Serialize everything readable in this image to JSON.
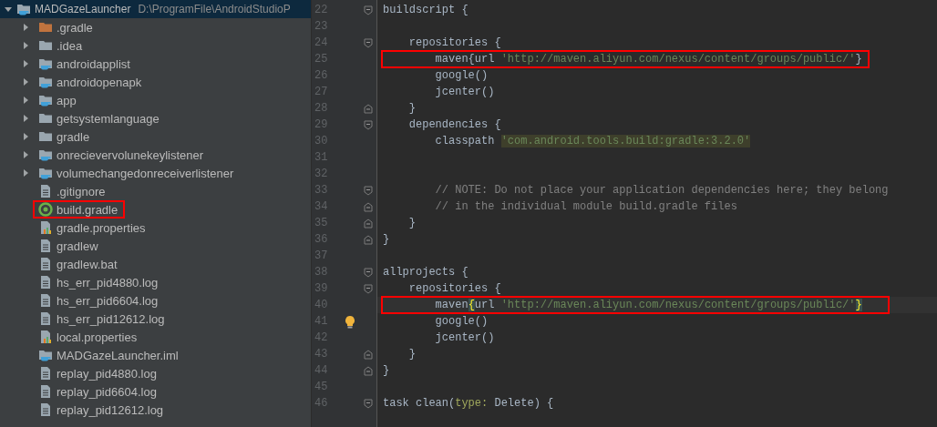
{
  "project_tree": {
    "root": {
      "name": "MADGazeLauncher",
      "path": "D:\\ProgramFile\\AndroidStudioP",
      "expanded": true
    },
    "items": [
      {
        "name": ".gradle",
        "kind": "excluded-folder",
        "expanded": false,
        "highlighted": false
      },
      {
        "name": ".idea",
        "kind": "folder",
        "expanded": false,
        "highlighted": false
      },
      {
        "name": "androidapplist",
        "kind": "module",
        "expanded": false,
        "highlighted": false
      },
      {
        "name": "androidopenapk",
        "kind": "module",
        "expanded": false,
        "highlighted": false
      },
      {
        "name": "app",
        "kind": "module",
        "expanded": false,
        "highlighted": false
      },
      {
        "name": "getsystemlanguage",
        "kind": "folder",
        "expanded": false,
        "highlighted": false
      },
      {
        "name": "gradle",
        "kind": "folder",
        "expanded": false,
        "highlighted": false
      },
      {
        "name": "onrecievervolunekeylistener",
        "kind": "module",
        "expanded": false,
        "highlighted": false
      },
      {
        "name": "volumechangedonreceiverlistener",
        "kind": "module",
        "expanded": false,
        "highlighted": false
      },
      {
        "name": ".gitignore",
        "kind": "file",
        "highlighted": false
      },
      {
        "name": "build.gradle",
        "kind": "gradle",
        "highlighted": true
      },
      {
        "name": "gradle.properties",
        "kind": "properties",
        "highlighted": false
      },
      {
        "name": "gradlew",
        "kind": "file",
        "highlighted": false
      },
      {
        "name": "gradlew.bat",
        "kind": "file",
        "highlighted": false
      },
      {
        "name": "hs_err_pid4880.log",
        "kind": "file",
        "highlighted": false
      },
      {
        "name": "hs_err_pid6604.log",
        "kind": "file",
        "highlighted": false
      },
      {
        "name": "hs_err_pid12612.log",
        "kind": "file",
        "highlighted": false
      },
      {
        "name": "local.properties",
        "kind": "properties",
        "highlighted": false
      },
      {
        "name": "MADGazeLauncher.iml",
        "kind": "iml",
        "highlighted": false
      },
      {
        "name": "replay_pid4880.log",
        "kind": "file",
        "highlighted": false
      },
      {
        "name": "replay_pid6604.log",
        "kind": "file",
        "highlighted": false
      },
      {
        "name": "replay_pid12612.log",
        "kind": "file",
        "highlighted": false
      }
    ]
  },
  "editor": {
    "lines": [
      {
        "number": "22",
        "fold_start": true,
        "segments": [
          {
            "kind": "plain",
            "text": "buildscript {"
          }
        ]
      },
      {
        "number": "23"
      },
      {
        "number": "24",
        "fold_start": true,
        "segments": [
          {
            "kind": "plain",
            "text": "    repositories {"
          }
        ]
      },
      {
        "number": "25",
        "highlighted": true,
        "segments": [
          {
            "kind": "plain",
            "text": "        maven{url "
          },
          {
            "kind": "string",
            "text": "'http://maven.aliyun.com/nexus/content/groups/public/'"
          },
          {
            "kind": "plain",
            "text": "}"
          }
        ]
      },
      {
        "number": "26",
        "segments": [
          {
            "kind": "plain",
            "text": "        google()"
          }
        ]
      },
      {
        "number": "27",
        "segments": [
          {
            "kind": "plain",
            "text": "        jcenter()"
          }
        ]
      },
      {
        "number": "28",
        "fold_end": true,
        "segments": [
          {
            "kind": "plain",
            "text": "    }"
          }
        ]
      },
      {
        "number": "29",
        "fold_start": true,
        "segments": [
          {
            "kind": "plain",
            "text": "    dependencies {"
          }
        ]
      },
      {
        "number": "30",
        "segments": [
          {
            "kind": "plain",
            "text": "        classpath "
          },
          {
            "kind": "marked-string",
            "text": "'com.android.tools.build:gradle:3.2.0'"
          }
        ]
      },
      {
        "number": "31"
      },
      {
        "number": "32"
      },
      {
        "number": "33",
        "fold_start": true,
        "segments": [
          {
            "kind": "comment",
            "text": "        // NOTE: Do not place your application dependencies here; they belong"
          }
        ]
      },
      {
        "number": "34",
        "fold_end": true,
        "segments": [
          {
            "kind": "comment",
            "text": "        // in the individual module build.gradle files"
          }
        ]
      },
      {
        "number": "35",
        "fold_end": true,
        "segments": [
          {
            "kind": "plain",
            "text": "    }"
          }
        ]
      },
      {
        "number": "36",
        "fold_end": true,
        "segments": [
          {
            "kind": "plain",
            "text": "}"
          }
        ]
      },
      {
        "number": "37"
      },
      {
        "number": "38",
        "fold_start": true,
        "segments": [
          {
            "kind": "plain",
            "text": "allprojects {"
          }
        ]
      },
      {
        "number": "39",
        "fold_start": true,
        "segments": [
          {
            "kind": "plain",
            "text": "    repositories {"
          }
        ]
      },
      {
        "number": "40",
        "highlighted": true,
        "current": true,
        "segments": [
          {
            "kind": "plain",
            "text": "        maven"
          },
          {
            "kind": "brace-match",
            "text": "{"
          },
          {
            "kind": "plain",
            "text": "url "
          },
          {
            "kind": "string",
            "text": "'http://maven.aliyun.com/nexus/content/groups/public/'"
          },
          {
            "kind": "brace-match",
            "text": "}"
          }
        ]
      },
      {
        "number": "41",
        "hint": true,
        "segments": [
          {
            "kind": "plain",
            "text": "        google()"
          }
        ]
      },
      {
        "number": "42",
        "segments": [
          {
            "kind": "plain",
            "text": "        jcenter()"
          }
        ]
      },
      {
        "number": "43",
        "fold_end": true,
        "segments": [
          {
            "kind": "plain",
            "text": "    }"
          }
        ]
      },
      {
        "number": "44",
        "fold_end": true,
        "segments": [
          {
            "kind": "plain",
            "text": "}"
          }
        ]
      },
      {
        "number": "45"
      },
      {
        "number": "46",
        "fold_start": true,
        "segments": [
          {
            "kind": "plain",
            "text": "task clean("
          },
          {
            "kind": "param",
            "text": "type:"
          },
          {
            "kind": "plain",
            "text": " Delete) {"
          }
        ]
      }
    ]
  }
}
